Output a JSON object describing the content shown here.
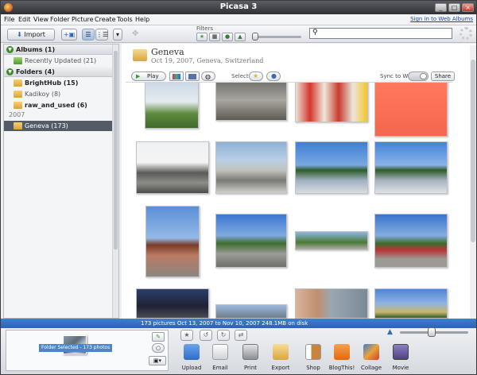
{
  "window": {
    "title": "Picasa 3",
    "buttons": [
      "_",
      "□",
      "×"
    ]
  },
  "menu": {
    "items": [
      "File",
      "Edit",
      "View",
      "Folder",
      "Picture",
      "Create",
      "Tools",
      "Help"
    ],
    "signin": "Sign in to Web Albums"
  },
  "toolbar": {
    "import_label": "Import",
    "filters_label": "Filters",
    "search_placeholder": ""
  },
  "sidebar": {
    "albums_header": "Albums (1)",
    "recently_updated": "Recently Updated (21)",
    "folders_header": "Folders (4)",
    "folders": [
      "BrightHub (15)",
      "Kadikoy (8)",
      "raw_and_used (6)"
    ],
    "year": "2007",
    "selected_folder": "Geneva (173)"
  },
  "folder": {
    "title": "Geneva",
    "subtitle": "Oct 19, 2007, Geneva, Switzerland",
    "play_label": "Play",
    "select_label": "Select",
    "sync_label": "Sync to Web",
    "share_label": "Share"
  },
  "status": {
    "summary": "173 pictures    Oct 13, 2007 to Nov 10, 2007    248.1MB on disk"
  },
  "tray": {
    "label": "Folder Selected - 173 photos"
  },
  "actions": [
    {
      "label": "Upload",
      "icon": "upload-icon",
      "color": "#3d7fd6"
    },
    {
      "label": "Email",
      "icon": "email-icon",
      "color": "#e8e8e8"
    },
    {
      "label": "Print",
      "icon": "print-icon",
      "color": "#9a9ea5"
    },
    {
      "label": "Export",
      "icon": "export-icon",
      "color": "#e8c16a"
    },
    {
      "label": "Shop",
      "icon": "shop-icon",
      "color": "#c9853f"
    },
    {
      "label": "BlogThis!",
      "icon": "blogger-icon",
      "color": "#f08a24"
    },
    {
      "label": "Collage",
      "icon": "collage-icon",
      "color": "#e07b3a"
    },
    {
      "label": "Movie",
      "icon": "movie-icon",
      "color": "#7c6aa8"
    }
  ]
}
